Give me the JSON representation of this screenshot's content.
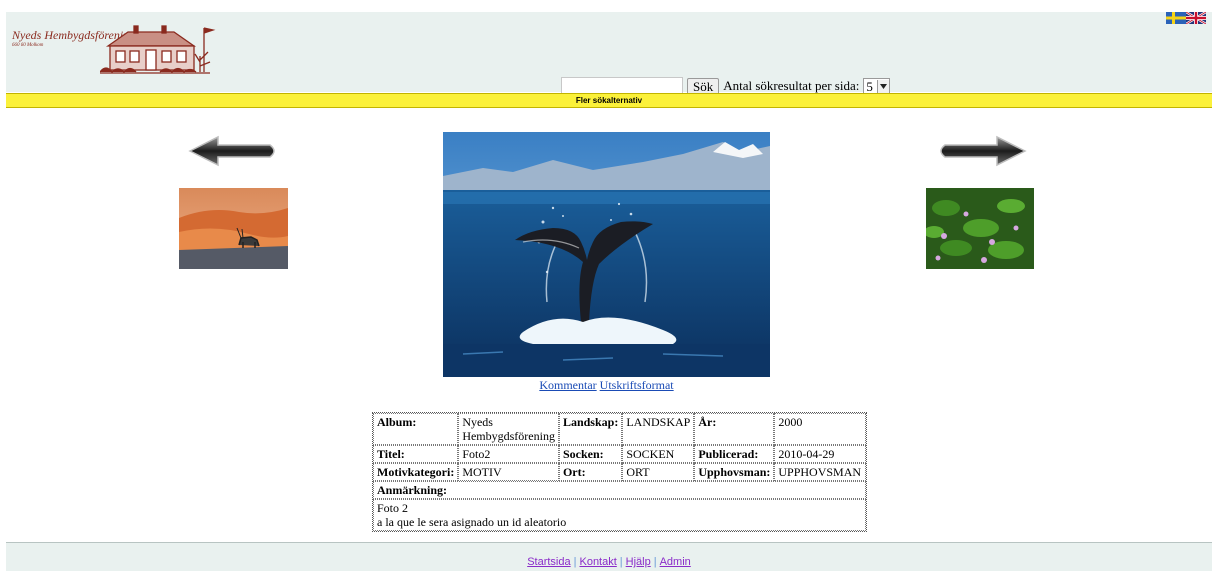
{
  "header": {
    "logo_name": "Nyeds Hembygdsförening",
    "logo_sub": "660 60 Molkom"
  },
  "flags": {
    "swedish": "swedish-flag-icon",
    "english": "english-flag-icon"
  },
  "search": {
    "input_value": "",
    "button_label": "Sök",
    "results_label": "Antal sökresultat per sida:",
    "results_value": "5"
  },
  "more_options": "Fler sökalternativ",
  "photo": {
    "comment_link": "Kommentar",
    "print_link": "Utskriftsformat"
  },
  "meta": {
    "album_label": "Album:",
    "album_value": "Nyeds Hembygdsförening",
    "landskap_label": "Landskap:",
    "landskap_value": "LANDSKAP",
    "ar_label": "År:",
    "ar_value": "2000",
    "titel_label": "Titel:",
    "titel_value": "Foto2",
    "socken_label": "Socken:",
    "socken_value": "SOCKEN",
    "publicerad_label": "Publicerad:",
    "publicerad_value": "2010-04-29",
    "motiv_label": "Motivkategori:",
    "motiv_value": "MOTIV",
    "ort_label": "Ort:",
    "ort_value": "ORT",
    "upphovsman_label": "Upphovsman:",
    "upphovsman_value": "UPPHOVSMAN",
    "anm_label": "Anmärkning:",
    "anm_line1": "Foto 2",
    "anm_line2": "a la que le sera asignado un id aleatorio"
  },
  "footer": {
    "start": "Startsida",
    "contact": "Kontakt",
    "help": "Hjälp",
    "admin": "Admin",
    "separator": "|"
  },
  "colors": {
    "header_bg": "#e9f1ef",
    "yellow_bar": "#fbf13a",
    "link_blue": "#1a4bb5",
    "visited_link": "#8a2bc9",
    "logo_red": "#8a2a1e"
  }
}
